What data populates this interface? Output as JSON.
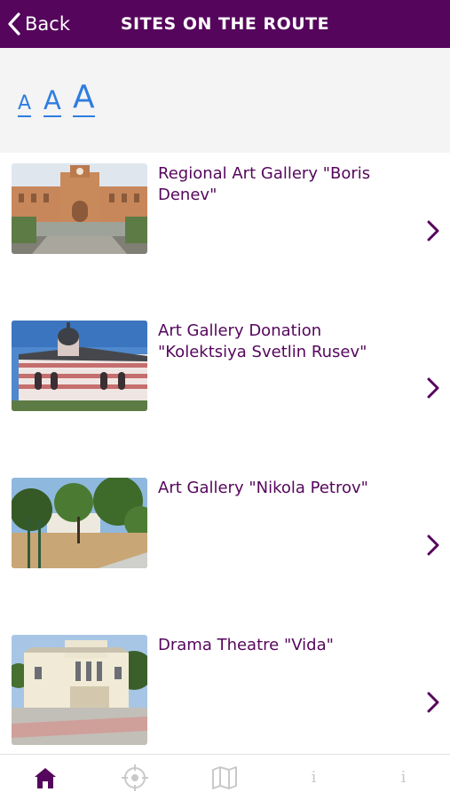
{
  "header": {
    "back_label": "Back",
    "title": "SITES ON THE ROUTE"
  },
  "font_size_controls": {
    "small": "A",
    "medium": "A",
    "large": "A"
  },
  "sites": [
    {
      "title": "Regional Art Gallery \"Boris Denev\""
    },
    {
      "title": "Art Gallery Donation \"Kolektsiya Svetlin Rusev\""
    },
    {
      "title": "Art Gallery \"Nikola Petrov\""
    },
    {
      "title": "Drama Theatre \"Vida\""
    }
  ],
  "tabbar": {
    "items": [
      {
        "icon": "home-icon",
        "active": true,
        "label": ""
      },
      {
        "icon": "location-target-icon",
        "active": false,
        "label": ""
      },
      {
        "icon": "map-icon",
        "active": false,
        "label": ""
      },
      {
        "icon": "info-icon",
        "active": false,
        "label": "i"
      },
      {
        "icon": "info-icon",
        "active": false,
        "label": "i"
      }
    ]
  },
  "colors": {
    "header": "#55065c",
    "accent": "#55065c",
    "font_control": "#2f7de1",
    "inactive_icon": "#c9c9c9"
  }
}
